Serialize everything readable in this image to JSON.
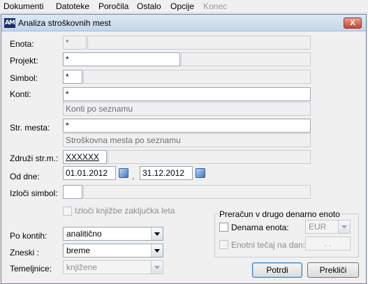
{
  "menu": {
    "items": [
      {
        "label": "Dokumenti",
        "disabled": false
      },
      {
        "label": "Datoteke",
        "disabled": false
      },
      {
        "label": "Poročila",
        "disabled": false
      },
      {
        "label": "Ostalo",
        "disabled": false
      },
      {
        "label": "Opcije",
        "disabled": false
      },
      {
        "label": "Konec",
        "disabled": true
      }
    ]
  },
  "dialog": {
    "title": "Analiza stroškovnih mest",
    "close_label": "X",
    "icon": "app-logo-icon",
    "fields": {
      "enota": {
        "label": "Enota:",
        "value": "*"
      },
      "projekt": {
        "label": "Projekt:",
        "value": "*"
      },
      "simbol": {
        "label": "Simbol:",
        "value": "*"
      },
      "konti": {
        "label": "Konti:",
        "value": "*",
        "note": "Konti po seznamu"
      },
      "str_mesta": {
        "label": "Str. mesta:",
        "value": "*",
        "note": "Stroškovna mesta po seznamu"
      },
      "zdruzi": {
        "label": "Združi str.m.:",
        "value": "XXXXXX"
      },
      "od_dne": {
        "label": "Od dne:",
        "from": "01.01.2012",
        "sep": ".",
        "to": "31.12.2012"
      },
      "izloci_simbol": {
        "label": "Izloči simbol:",
        "value": ""
      }
    },
    "izloci_knjizbe": {
      "label": "Izloči knjižbe zaključka leta",
      "checked": false
    },
    "po_kontih": {
      "label": "Po kontih:",
      "selected": "analitično"
    },
    "zneski": {
      "label": "Zneski :",
      "selected": "breme"
    },
    "temeljnice": {
      "label": "Temeljnice:",
      "selected": "knjižene"
    },
    "currency_group": {
      "title": "Preračun v drugo denarno enoto",
      "denarna_enota": {
        "label": "Denarna enota:",
        "checked": false,
        "selected": "EUR"
      },
      "enotni_tecaj": {
        "label": "Enotni tečaj na dan:",
        "checked": false,
        "value": ". ."
      }
    },
    "buttons": {
      "potrdi": "Potrdi",
      "preklici": "Prekliči"
    }
  }
}
